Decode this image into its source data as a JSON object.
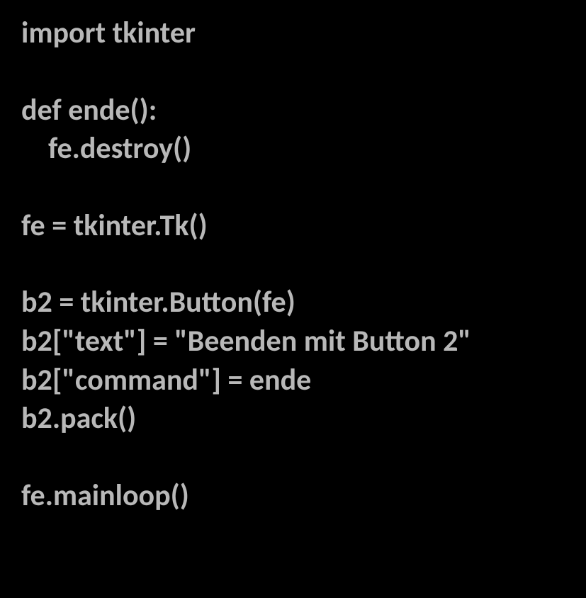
{
  "code": {
    "line1": "import tkinter",
    "line2": "def ende():",
    "line3": "    fe.destroy()",
    "line4": "fe = tkinter.Tk()",
    "line5": "b2 = tkinter.Button(fe)",
    "line6": "b2[\"text\"] = \"Beenden mit Button 2\"",
    "line7": "b2[\"command\"] = ende",
    "line8": "b2.pack()",
    "line9": "fe.mainloop()"
  }
}
